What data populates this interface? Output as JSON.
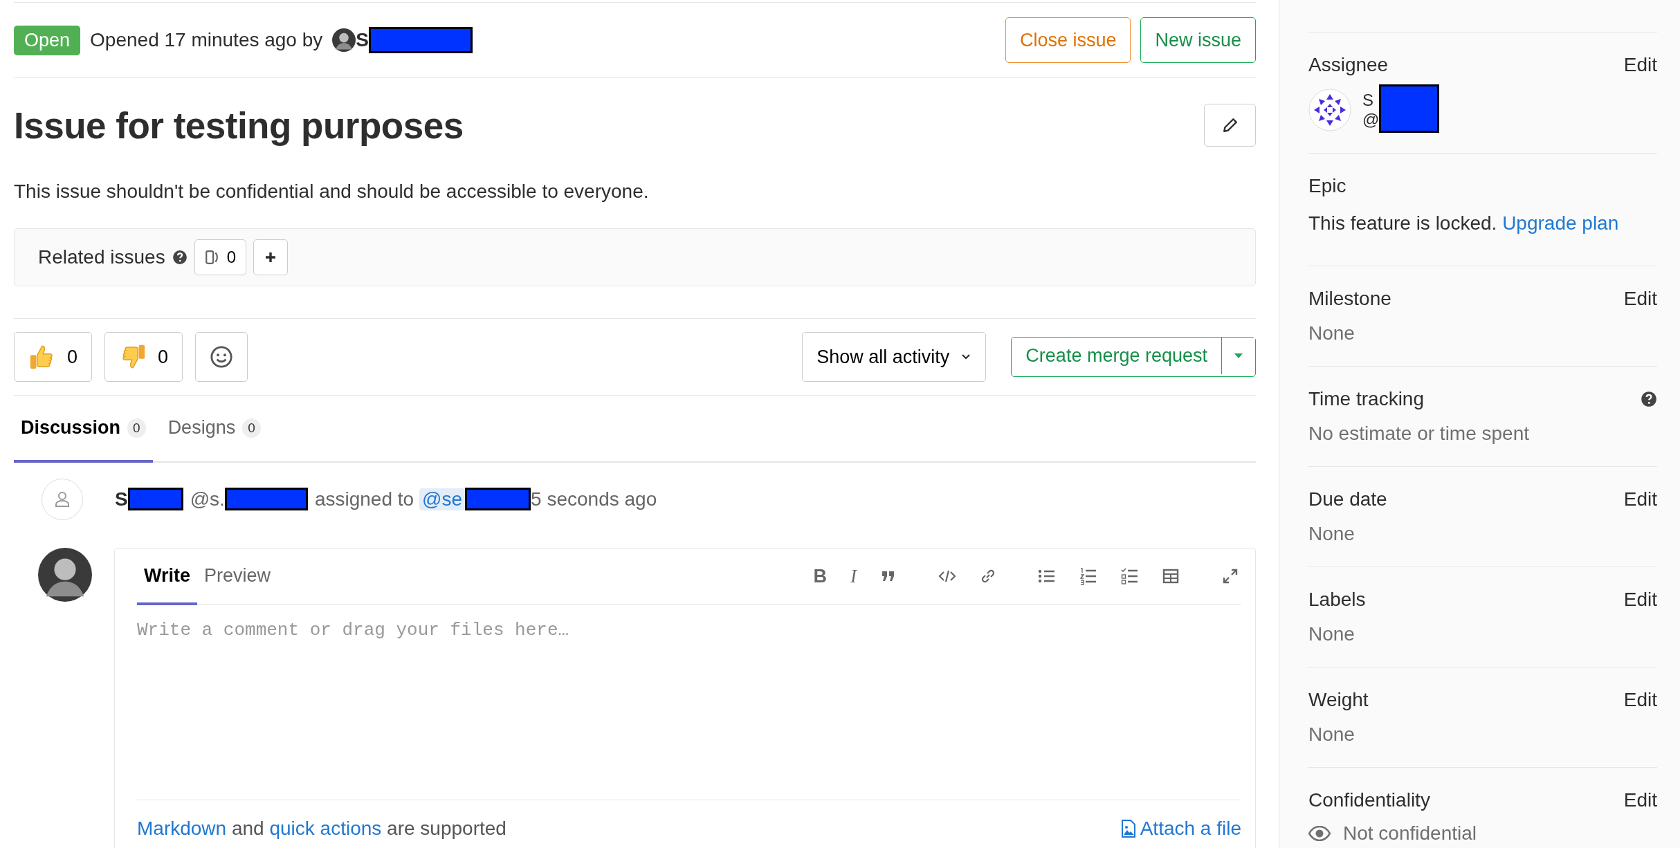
{
  "issue_header": {
    "status": "Open",
    "opened_text": "Opened 17 minutes ago by",
    "author": "S",
    "buttons": [
      {
        "label": "Close issue",
        "kind": "warning"
      },
      {
        "label": "New issue",
        "kind": "success"
      }
    ]
  },
  "title": "Issue for testing purposes",
  "description": "This issue shouldn't be confidential and should be accessible to everyone.",
  "related_issues": {
    "label": "Related issues",
    "count": "0"
  },
  "awards": [
    {
      "kind": "thumbsup",
      "count": "0"
    },
    {
      "kind": "thumbsdown",
      "count": "0"
    }
  ],
  "activity_filter": "Show all activity",
  "merge_request_button": "Create merge request",
  "tabs": [
    {
      "label": "Discussion",
      "count": "0",
      "selected": true
    },
    {
      "label": "Designs",
      "count": "0",
      "selected": false
    }
  ],
  "system_note": {
    "author": "S",
    "username": "@s.",
    "action": "assigned to",
    "mention": "@se",
    "time": "5 seconds ago"
  },
  "editor": {
    "tabs": [
      {
        "label": "Write",
        "selected": true
      },
      {
        "label": "Preview",
        "selected": false
      }
    ],
    "toolbar": [
      {
        "kind": "bold",
        "glyph": "B"
      },
      {
        "kind": "italic",
        "glyph": "I"
      },
      {
        "kind": "quote"
      },
      {
        "kind": "code"
      },
      {
        "kind": "link"
      },
      {
        "kind": "bullets"
      },
      {
        "kind": "numbers"
      },
      {
        "kind": "tasks"
      },
      {
        "kind": "table"
      },
      {
        "kind": "fullscreen"
      }
    ],
    "placeholder": "Write a comment or drag your files here…",
    "footer": [
      {
        "kind": "link",
        "text": "Markdown"
      },
      {
        "kind": "text",
        "text": "and"
      },
      {
        "kind": "link",
        "text": "quick actions"
      },
      {
        "kind": "text",
        "text": "are supported"
      }
    ],
    "attach": "Attach a file"
  },
  "sidebar": [
    {
      "kind": "assignee",
      "title": "Assignee",
      "action": "Edit",
      "name": "S",
      "username": "@"
    },
    {
      "kind": "epic",
      "title": "Epic",
      "text": "This feature is locked.",
      "link": "Upgrade plan"
    },
    {
      "kind": "value",
      "title": "Milestone",
      "action": "Edit",
      "value": "None"
    },
    {
      "kind": "time",
      "title": "Time tracking",
      "value": "No estimate or time spent"
    },
    {
      "kind": "value",
      "title": "Due date",
      "action": "Edit",
      "value": "None"
    },
    {
      "kind": "value",
      "title": "Labels",
      "action": "Edit",
      "value": "None"
    },
    {
      "kind": "value",
      "title": "Weight",
      "action": "Edit",
      "value": "None"
    },
    {
      "kind": "confidentiality",
      "title": "Confidentiality",
      "action": "Edit",
      "value": "Not confidential"
    }
  ]
}
